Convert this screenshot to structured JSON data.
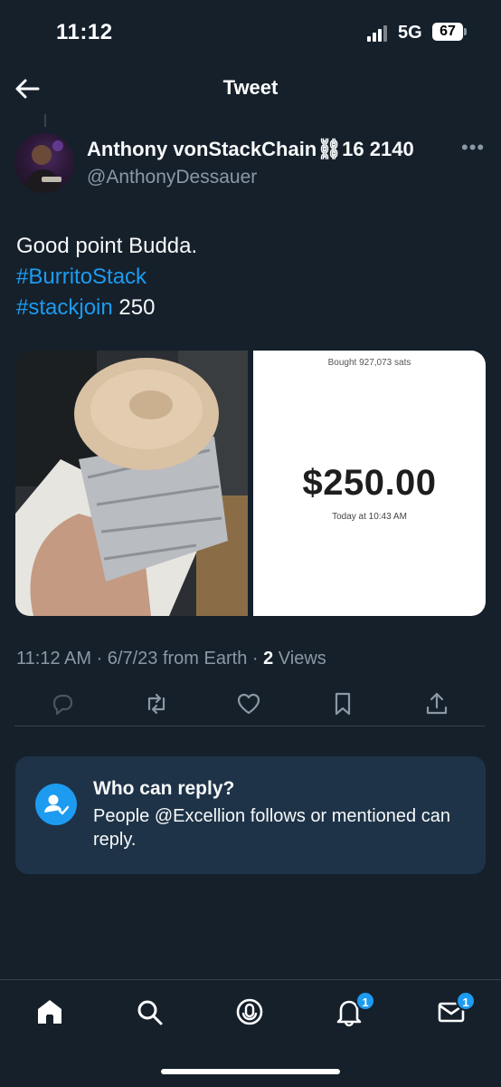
{
  "status_bar": {
    "time": "11:12",
    "network": "5G",
    "battery": "67"
  },
  "header": {
    "title": "Tweet"
  },
  "tweet": {
    "display_name": "Anthony vonStackChain⛓16 2140",
    "handle": "@AnthonyDessauer",
    "text_line1": "Good point Budda.",
    "hashtag1": "#BurritoStack",
    "hashtag2": "#stackjoin",
    "text_after_hashtag2": " 250",
    "media_receipt": {
      "bought": "Bought 927,073 sats",
      "amount": "$250.00",
      "time": "Today at 10:43 AM"
    },
    "timestamp": "11:12 AM · 6/7/23 from Earth · ",
    "views_count": "2",
    "views_label": " Views"
  },
  "reply_settings": {
    "title": "Who can reply?",
    "description": "People @Excellion follows or mentioned can reply."
  },
  "tabbar": {
    "notifications_badge": "1",
    "messages_badge": "1"
  },
  "colors": {
    "accent": "#1d9bf0",
    "background": "#15202b",
    "card": "#1e3348",
    "muted": "#8b98a5"
  }
}
